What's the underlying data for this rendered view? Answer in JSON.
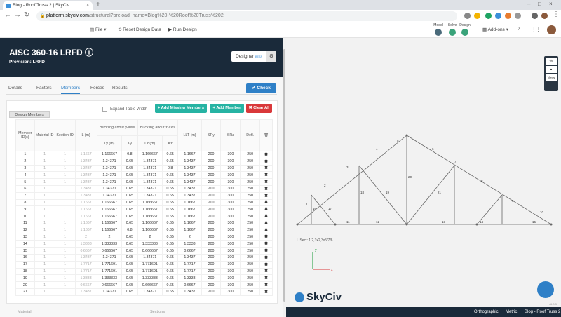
{
  "browser": {
    "tab_title": "Blog - Roof Truss 2 | SkyCiv",
    "url_host": "platform.skyciv.com",
    "url_path": "/structural?preload_name=Blog%20-%20Roof%20Truss%202"
  },
  "appbar": {
    "file": "File",
    "reset": "Reset Design Data",
    "run": "Run Design",
    "mode_labels": [
      "Model",
      "Solve",
      "Design"
    ],
    "addons": "Add-ons"
  },
  "panel": {
    "title": "AISC 360-16 LRFD",
    "provision": "Provision: LRFD",
    "designer_label": "Designer",
    "designer_badge": "BETA",
    "tabs": [
      "Details",
      "Factors",
      "Members",
      "Forces",
      "Results"
    ],
    "active_tab": "Members",
    "check_label": "Check",
    "design_members_tag": "Design Members",
    "expand_label": "Expand Table Width",
    "add_missing_label": "Add Missing Members",
    "add_member_label": "Add Member",
    "clear_all_label": "Clear All",
    "bottom_left": "Material",
    "bottom_right": "Sections"
  },
  "table": {
    "headers": {
      "member": "Member ID(s)",
      "material": "Material ID",
      "section": "Section ID",
      "L": "L (m)",
      "buckling_y": "Buckling about y-axis",
      "buckling_z": "Buckling about z-axis",
      "Ly": "Ly (m)",
      "Ky": "Ky",
      "Lz": "Lz (m)",
      "Kz": "Kz",
      "Ltb": "LLT (m)",
      "sry": "SRy",
      "srz": "SRz",
      "defl": "Defl."
    },
    "rows": [
      [
        "1",
        "1",
        "1",
        "1.1667",
        "1.166667",
        "0.8",
        "1.166667",
        "0.65",
        "1.1667",
        "200",
        "300",
        "250"
      ],
      [
        "2",
        "1",
        "1",
        "1.3437",
        "1.34371",
        "0.65",
        "1.34371",
        "0.65",
        "1.3437",
        "200",
        "300",
        "250"
      ],
      [
        "3",
        "1",
        "1",
        "1.3437",
        "1.34371",
        "0.65",
        "1.34371",
        "0.8",
        "1.3437",
        "200",
        "300",
        "250"
      ],
      [
        "4",
        "1",
        "1",
        "1.3437",
        "1.34371",
        "0.65",
        "1.34371",
        "0.65",
        "1.3437",
        "200",
        "300",
        "250"
      ],
      [
        "5",
        "1",
        "1",
        "1.3437",
        "1.34371",
        "0.65",
        "1.34371",
        "0.65",
        "1.3437",
        "200",
        "300",
        "250"
      ],
      [
        "6",
        "1",
        "1",
        "1.3437",
        "1.34371",
        "0.65",
        "1.34371",
        "0.65",
        "1.3437",
        "200",
        "300",
        "250"
      ],
      [
        "7",
        "1",
        "1",
        "1.3437",
        "1.34371",
        "0.65",
        "1.34371",
        "0.65",
        "1.3437",
        "200",
        "300",
        "250"
      ],
      [
        "8",
        "1",
        "1",
        "1.1667",
        "1.166667",
        "0.65",
        "1.166667",
        "0.65",
        "1.1667",
        "200",
        "300",
        "250"
      ],
      [
        "9",
        "1",
        "1",
        "1.1667",
        "1.166667",
        "0.65",
        "1.166667",
        "0.65",
        "1.1667",
        "200",
        "300",
        "250"
      ],
      [
        "10",
        "1",
        "1",
        "1.1667",
        "1.166667",
        "0.65",
        "1.166667",
        "0.65",
        "1.1667",
        "200",
        "300",
        "250"
      ],
      [
        "11",
        "1",
        "1",
        "1.1667",
        "1.166667",
        "0.65",
        "1.166667",
        "0.65",
        "1.1667",
        "200",
        "300",
        "250"
      ],
      [
        "12",
        "1",
        "1",
        "1.1667",
        "1.166667",
        "0.8",
        "1.166667",
        "0.65",
        "1.1667",
        "200",
        "300",
        "250"
      ],
      [
        "13",
        "1",
        "1",
        "2",
        "2",
        "0.65",
        "2",
        "0.65",
        "2",
        "200",
        "300",
        "250"
      ],
      [
        "14",
        "1",
        "1",
        "1.3333",
        "1.333333",
        "0.65",
        "1.333333",
        "0.65",
        "1.3333",
        "200",
        "300",
        "250"
      ],
      [
        "15",
        "1",
        "1",
        "0.6667",
        "0.666667",
        "0.65",
        "0.666667",
        "0.65",
        "0.6667",
        "200",
        "300",
        "250"
      ],
      [
        "16",
        "1",
        "1",
        "1.3437",
        "1.34371",
        "0.65",
        "1.34371",
        "0.65",
        "1.3437",
        "200",
        "300",
        "250"
      ],
      [
        "17",
        "1",
        "1",
        "1.7717",
        "1.771691",
        "0.65",
        "1.771691",
        "0.65",
        "1.7717",
        "200",
        "300",
        "250"
      ],
      [
        "18",
        "1",
        "1",
        "1.7717",
        "1.771691",
        "0.65",
        "1.771691",
        "0.65",
        "1.7717",
        "200",
        "300",
        "250"
      ],
      [
        "19",
        "1",
        "1",
        "1.3333",
        "1.333333",
        "0.65",
        "1.333333",
        "0.65",
        "1.3333",
        "200",
        "300",
        "250"
      ],
      [
        "20",
        "1",
        "1",
        "0.6667",
        "0.666667",
        "0.65",
        "0.666667",
        "0.65",
        "0.6667",
        "200",
        "300",
        "250"
      ],
      [
        "21",
        "1",
        "1",
        "1.3437",
        "1.34371",
        "0.65",
        "1.34371",
        "0.65",
        "1.3437",
        "200",
        "300",
        "250"
      ]
    ]
  },
  "canvas": {
    "info_line": "Sect: 1,2,3x2,3x5/7/6",
    "member_labels": [
      "1",
      "2",
      "3",
      "4",
      "5",
      "6",
      "7",
      "8",
      "9",
      "10",
      "11",
      "12",
      "13",
      "14",
      "15",
      "16",
      "17",
      "18",
      "19",
      "20",
      "21"
    ],
    "axis_y": "y",
    "axis_x": "x",
    "brand": "SkyCiv",
    "version": "v6.0.3"
  },
  "statusbar": {
    "view": "Orthographic",
    "units": "Metric",
    "project": "Blog - Roof Truss 2"
  }
}
